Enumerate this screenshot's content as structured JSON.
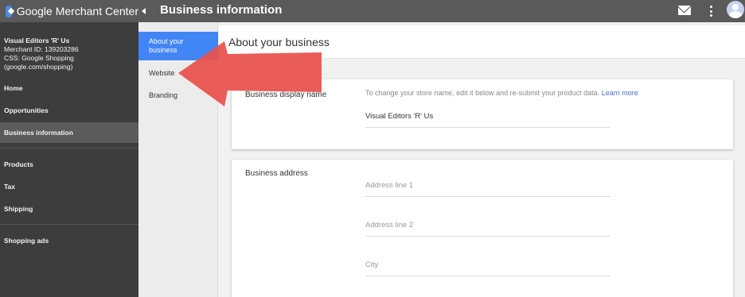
{
  "topbar": {
    "brand": "Google Merchant Center",
    "title": "Business information",
    "icons": [
      "mail-icon",
      "more-vert-icon",
      "avatar"
    ]
  },
  "account": {
    "name": "Visual Editors 'R' Us",
    "merchant_id": "Merchant ID: 139203286",
    "css_line1": "CSS: Google Shopping",
    "css_line2": "(google.com/shopping)"
  },
  "sidebar": {
    "items": [
      {
        "label": "Home"
      },
      {
        "label": "Opportunities"
      },
      {
        "label": "Business information",
        "active": true
      },
      {
        "label": "Products"
      },
      {
        "label": "Tax"
      },
      {
        "label": "Shipping"
      },
      {
        "label": "Shopping ads"
      }
    ]
  },
  "subnav": {
    "items": [
      {
        "label": "About your business",
        "active": true
      },
      {
        "label": "Website"
      },
      {
        "label": "Branding"
      }
    ]
  },
  "main": {
    "title": "About your business",
    "display_name_card": {
      "label": "Business display name",
      "help": "To change your store name, edit it below and re-submit your product data.",
      "learn_more": "Learn more",
      "value": "Visual Editors 'R' Us"
    },
    "address_card": {
      "label": "Business address",
      "address1_placeholder": "Address line 1",
      "address2_placeholder": "Address line 2",
      "city_placeholder": "City"
    }
  },
  "colors": {
    "topbar": "#5a5a5a",
    "sidebar": "#3d3d3d",
    "accent": "#4285f4",
    "annotation": "#e8534f"
  }
}
